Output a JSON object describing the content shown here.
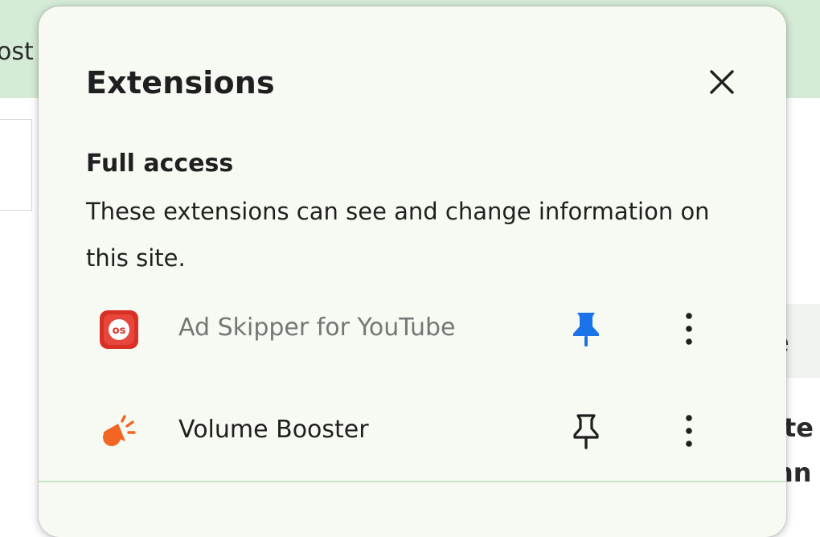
{
  "background": {
    "topbar_text": "ost",
    "chip_text": "e",
    "line1_text": "ite",
    "line2_text": "nn"
  },
  "popup": {
    "title": "Extensions",
    "close_icon": "close-icon",
    "section": {
      "title": "Full access",
      "description": "These extensions can see and change information on this site."
    },
    "extensions": [
      {
        "name": "Ad Skipper for YouTube",
        "icon": "ad-skipper-icon",
        "icon_text": "os",
        "pinned": true,
        "pin_icon": "pin-filled-icon",
        "more_icon": "more-vert-icon"
      },
      {
        "name": "Volume Booster",
        "icon": "volume-booster-icon",
        "pinned": false,
        "pin_icon": "pin-outline-icon",
        "more_icon": "more-vert-icon"
      }
    ]
  },
  "colors": {
    "topbar_bg": "#d4ebd6",
    "popup_bg": "#f6faf2",
    "pin_active": "#1a73e8",
    "ad_skipper_red": "#d93025",
    "volume_booster_orange": "#f26522",
    "divider": "#c7e6c6"
  }
}
